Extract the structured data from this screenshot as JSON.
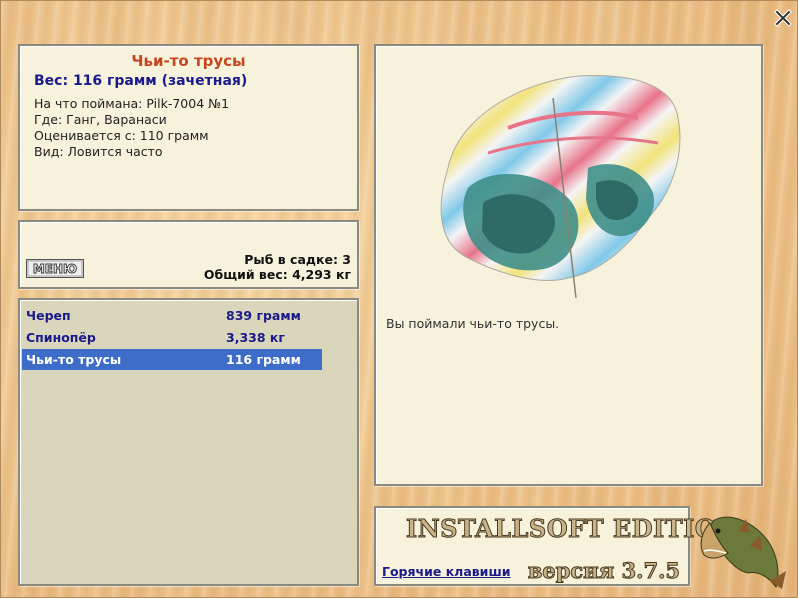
{
  "window": {
    "close_icon": "close-icon"
  },
  "info": {
    "name": "Чьи-то трусы",
    "weight": "Вес: 116 грамм (зачетная)",
    "lines": [
      "На что поймана: Pilk-7004 №1",
      "Где: Ганг, Варанаси",
      "Оценивается с: 110 грамм",
      "Вид: Ловится часто"
    ]
  },
  "stats": {
    "menu_label": "МЕНЮ",
    "fish_count": "Рыб в садке: 3",
    "total_weight": "Общий вес: 4,293 кг"
  },
  "catch_list": [
    {
      "name": "Череп",
      "weight": "839 грамм",
      "selected": false
    },
    {
      "name": "Спинопёр",
      "weight": "3,338 кг",
      "selected": false
    },
    {
      "name": "Чьи-то трусы",
      "weight": "116 грамм",
      "selected": true
    }
  ],
  "picture": {
    "caption": "Вы поймали чьи-то трусы."
  },
  "brand": {
    "title": "INSTALLSOFT EDITION",
    "hotkeys": "Горячие клавиши",
    "version": "версия 3.7.5"
  },
  "colors": {
    "name_accent": "#c8461e",
    "link_blue": "#1a1a8c",
    "selection": "#3d6dc8"
  }
}
